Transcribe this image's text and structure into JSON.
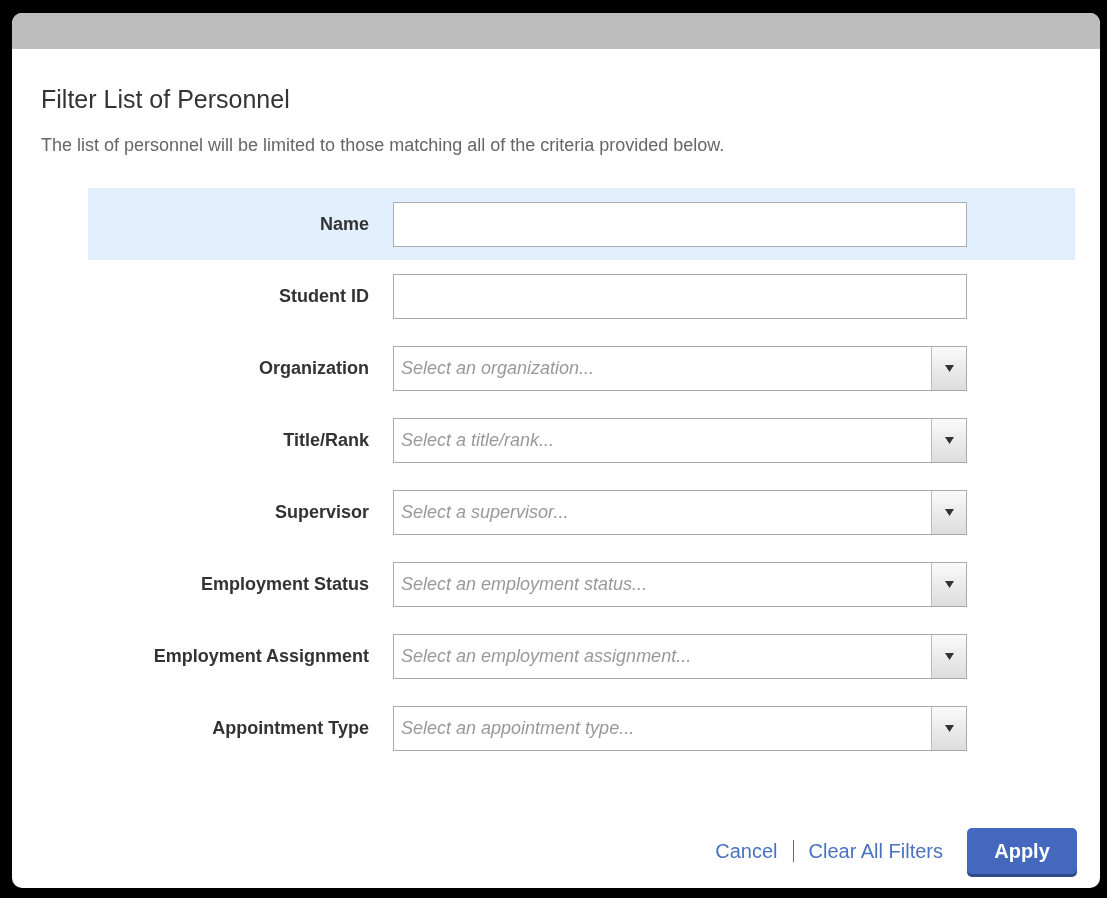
{
  "dialog": {
    "title": "Filter List of Personnel",
    "description": "The list of personnel will be limited to those matching all of the criteria provided below."
  },
  "fields": [
    {
      "label": "Name",
      "kind": "text",
      "highlighted": true
    },
    {
      "label": "Student ID",
      "kind": "text",
      "highlighted": false
    },
    {
      "label": "Organization",
      "kind": "select",
      "placeholder": "Select an organization...",
      "highlighted": false
    },
    {
      "label": "Title/Rank",
      "kind": "select",
      "placeholder": "Select a title/rank...",
      "highlighted": false
    },
    {
      "label": "Supervisor",
      "kind": "select",
      "placeholder": "Select a supervisor...",
      "highlighted": false
    },
    {
      "label": "Employment Status",
      "kind": "select",
      "placeholder": "Select an employment status...",
      "highlighted": false
    },
    {
      "label": "Employment Assignment",
      "kind": "select",
      "placeholder": "Select an employment assignment...",
      "highlighted": false
    },
    {
      "label": "Appointment Type",
      "kind": "select",
      "placeholder": "Select an appointment type...",
      "highlighted": false
    }
  ],
  "links": [
    "Cancel",
    "Clear All Filters"
  ],
  "apply_button": "Apply"
}
